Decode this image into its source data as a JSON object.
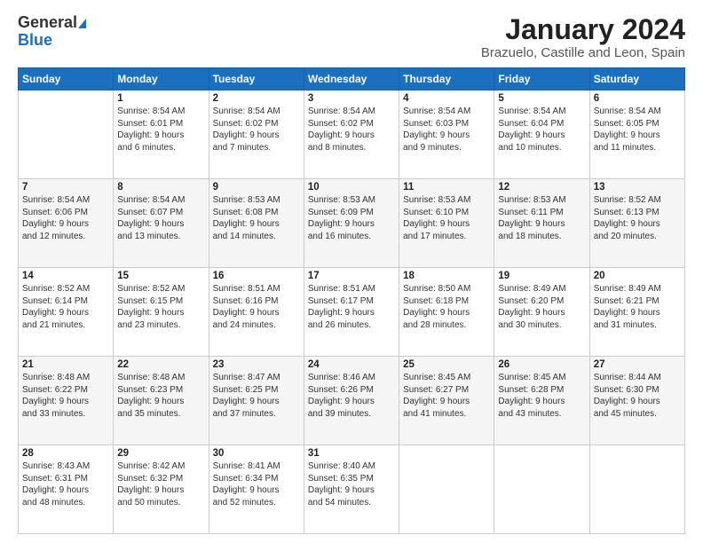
{
  "logo": {
    "general": "General",
    "blue": "Blue"
  },
  "title": "January 2024",
  "subtitle": "Brazuelo, Castille and Leon, Spain",
  "days_header": [
    "Sunday",
    "Monday",
    "Tuesday",
    "Wednesday",
    "Thursday",
    "Friday",
    "Saturday"
  ],
  "weeks": [
    [
      {
        "day": "",
        "lines": []
      },
      {
        "day": "1",
        "lines": [
          "Sunrise: 8:54 AM",
          "Sunset: 6:01 PM",
          "Daylight: 9 hours",
          "and 6 minutes."
        ]
      },
      {
        "day": "2",
        "lines": [
          "Sunrise: 8:54 AM",
          "Sunset: 6:02 PM",
          "Daylight: 9 hours",
          "and 7 minutes."
        ]
      },
      {
        "day": "3",
        "lines": [
          "Sunrise: 8:54 AM",
          "Sunset: 6:02 PM",
          "Daylight: 9 hours",
          "and 8 minutes."
        ]
      },
      {
        "day": "4",
        "lines": [
          "Sunrise: 8:54 AM",
          "Sunset: 6:03 PM",
          "Daylight: 9 hours",
          "and 9 minutes."
        ]
      },
      {
        "day": "5",
        "lines": [
          "Sunrise: 8:54 AM",
          "Sunset: 6:04 PM",
          "Daylight: 9 hours",
          "and 10 minutes."
        ]
      },
      {
        "day": "6",
        "lines": [
          "Sunrise: 8:54 AM",
          "Sunset: 6:05 PM",
          "Daylight: 9 hours",
          "and 11 minutes."
        ]
      }
    ],
    [
      {
        "day": "7",
        "lines": [
          "Sunrise: 8:54 AM",
          "Sunset: 6:06 PM",
          "Daylight: 9 hours",
          "and 12 minutes."
        ]
      },
      {
        "day": "8",
        "lines": [
          "Sunrise: 8:54 AM",
          "Sunset: 6:07 PM",
          "Daylight: 9 hours",
          "and 13 minutes."
        ]
      },
      {
        "day": "9",
        "lines": [
          "Sunrise: 8:53 AM",
          "Sunset: 6:08 PM",
          "Daylight: 9 hours",
          "and 14 minutes."
        ]
      },
      {
        "day": "10",
        "lines": [
          "Sunrise: 8:53 AM",
          "Sunset: 6:09 PM",
          "Daylight: 9 hours",
          "and 16 minutes."
        ]
      },
      {
        "day": "11",
        "lines": [
          "Sunrise: 8:53 AM",
          "Sunset: 6:10 PM",
          "Daylight: 9 hours",
          "and 17 minutes."
        ]
      },
      {
        "day": "12",
        "lines": [
          "Sunrise: 8:53 AM",
          "Sunset: 6:11 PM",
          "Daylight: 9 hours",
          "and 18 minutes."
        ]
      },
      {
        "day": "13",
        "lines": [
          "Sunrise: 8:52 AM",
          "Sunset: 6:13 PM",
          "Daylight: 9 hours",
          "and 20 minutes."
        ]
      }
    ],
    [
      {
        "day": "14",
        "lines": [
          "Sunrise: 8:52 AM",
          "Sunset: 6:14 PM",
          "Daylight: 9 hours",
          "and 21 minutes."
        ]
      },
      {
        "day": "15",
        "lines": [
          "Sunrise: 8:52 AM",
          "Sunset: 6:15 PM",
          "Daylight: 9 hours",
          "and 23 minutes."
        ]
      },
      {
        "day": "16",
        "lines": [
          "Sunrise: 8:51 AM",
          "Sunset: 6:16 PM",
          "Daylight: 9 hours",
          "and 24 minutes."
        ]
      },
      {
        "day": "17",
        "lines": [
          "Sunrise: 8:51 AM",
          "Sunset: 6:17 PM",
          "Daylight: 9 hours",
          "and 26 minutes."
        ]
      },
      {
        "day": "18",
        "lines": [
          "Sunrise: 8:50 AM",
          "Sunset: 6:18 PM",
          "Daylight: 9 hours",
          "and 28 minutes."
        ]
      },
      {
        "day": "19",
        "lines": [
          "Sunrise: 8:49 AM",
          "Sunset: 6:20 PM",
          "Daylight: 9 hours",
          "and 30 minutes."
        ]
      },
      {
        "day": "20",
        "lines": [
          "Sunrise: 8:49 AM",
          "Sunset: 6:21 PM",
          "Daylight: 9 hours",
          "and 31 minutes."
        ]
      }
    ],
    [
      {
        "day": "21",
        "lines": [
          "Sunrise: 8:48 AM",
          "Sunset: 6:22 PM",
          "Daylight: 9 hours",
          "and 33 minutes."
        ]
      },
      {
        "day": "22",
        "lines": [
          "Sunrise: 8:48 AM",
          "Sunset: 6:23 PM",
          "Daylight: 9 hours",
          "and 35 minutes."
        ]
      },
      {
        "day": "23",
        "lines": [
          "Sunrise: 8:47 AM",
          "Sunset: 6:25 PM",
          "Daylight: 9 hours",
          "and 37 minutes."
        ]
      },
      {
        "day": "24",
        "lines": [
          "Sunrise: 8:46 AM",
          "Sunset: 6:26 PM",
          "Daylight: 9 hours",
          "and 39 minutes."
        ]
      },
      {
        "day": "25",
        "lines": [
          "Sunrise: 8:45 AM",
          "Sunset: 6:27 PM",
          "Daylight: 9 hours",
          "and 41 minutes."
        ]
      },
      {
        "day": "26",
        "lines": [
          "Sunrise: 8:45 AM",
          "Sunset: 6:28 PM",
          "Daylight: 9 hours",
          "and 43 minutes."
        ]
      },
      {
        "day": "27",
        "lines": [
          "Sunrise: 8:44 AM",
          "Sunset: 6:30 PM",
          "Daylight: 9 hours",
          "and 45 minutes."
        ]
      }
    ],
    [
      {
        "day": "28",
        "lines": [
          "Sunrise: 8:43 AM",
          "Sunset: 6:31 PM",
          "Daylight: 9 hours",
          "and 48 minutes."
        ]
      },
      {
        "day": "29",
        "lines": [
          "Sunrise: 8:42 AM",
          "Sunset: 6:32 PM",
          "Daylight: 9 hours",
          "and 50 minutes."
        ]
      },
      {
        "day": "30",
        "lines": [
          "Sunrise: 8:41 AM",
          "Sunset: 6:34 PM",
          "Daylight: 9 hours",
          "and 52 minutes."
        ]
      },
      {
        "day": "31",
        "lines": [
          "Sunrise: 8:40 AM",
          "Sunset: 6:35 PM",
          "Daylight: 9 hours",
          "and 54 minutes."
        ]
      },
      {
        "day": "",
        "lines": []
      },
      {
        "day": "",
        "lines": []
      },
      {
        "day": "",
        "lines": []
      }
    ]
  ]
}
